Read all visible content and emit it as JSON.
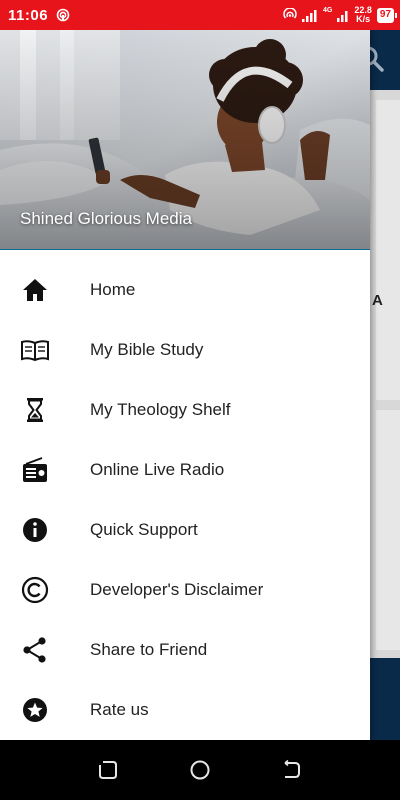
{
  "status_bar": {
    "time": "11:06",
    "net_type": "4G",
    "net_rate_value": "22.8",
    "net_rate_unit": "K/s",
    "battery": "97"
  },
  "drawer": {
    "header_title": "Shined Glorious Media",
    "items": [
      {
        "label": "Home",
        "icon": "home-icon"
      },
      {
        "label": "My Bible Study",
        "icon": "open-book-icon"
      },
      {
        "label": "My Theology Shelf",
        "icon": "hourglass-icon"
      },
      {
        "label": "Online Live Radio",
        "icon": "radio-icon"
      },
      {
        "label": "Quick Support",
        "icon": "info-icon"
      },
      {
        "label": "Developer's Disclaimer",
        "icon": "copyright-icon"
      },
      {
        "label": "Share to Friend",
        "icon": "share-icon"
      },
      {
        "label": "Rate us",
        "icon": "star-circle-icon"
      }
    ]
  },
  "background_app": {
    "partial_letter": "A"
  },
  "colors": {
    "status_bar": "#e8141c",
    "toolbar": "#0a2a4a",
    "header_stripe": "#0e6a8e",
    "icon": "#111111"
  }
}
